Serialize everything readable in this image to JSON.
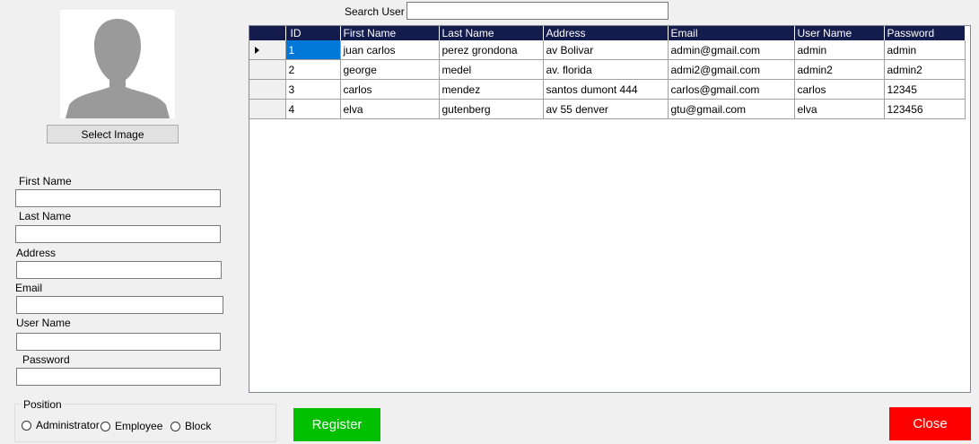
{
  "search": {
    "label": "Search User",
    "value": ""
  },
  "profile": {
    "select_image_label": "Select Image"
  },
  "form": {
    "first_name_label": "First Name",
    "last_name_label": "Last Name",
    "address_label": "Address",
    "email_label": "Email",
    "username_label": "User Name",
    "password_label": "Password"
  },
  "position": {
    "title": "Position",
    "options": [
      "Administrator",
      "Employee",
      "Block"
    ]
  },
  "grid": {
    "columns": [
      "ID",
      "First Name",
      "Last Name",
      "Address",
      "Email",
      "User Name",
      "Password"
    ],
    "rows": [
      [
        "1",
        "juan carlos",
        "perez grondona",
        "av Bolivar",
        "admin@gmail.com",
        "admin",
        "admin"
      ],
      [
        "2",
        "george",
        "medel",
        "av. florida",
        "admi2@gmail.com",
        "admin2",
        "admin2"
      ],
      [
        "3",
        "carlos",
        "mendez",
        "santos dumont 444",
        "carlos@gmail.com",
        "carlos",
        "12345"
      ],
      [
        "4",
        "elva",
        "gutenberg",
        "av 55 denver",
        "gtu@gmail.com",
        "elva",
        "123456"
      ]
    ]
  },
  "actions": {
    "register_label": "Register",
    "close_label": "Close"
  },
  "colors": {
    "grid_header": "#141b4d",
    "selection": "#0078d7",
    "register": "#00c000",
    "close": "#ff0000"
  }
}
